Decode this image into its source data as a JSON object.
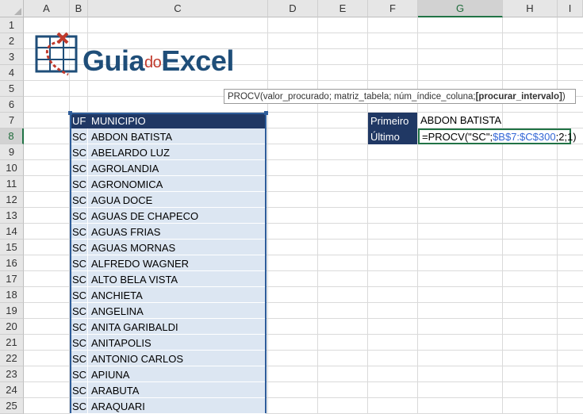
{
  "columns": [
    "A",
    "B",
    "C",
    "D",
    "E",
    "F",
    "G",
    "H",
    "I"
  ],
  "selected_column": "G",
  "rows": [
    "1",
    "2",
    "3",
    "4",
    "5",
    "6",
    "7",
    "8",
    "9",
    "10",
    "11",
    "12",
    "13",
    "14",
    "15",
    "16",
    "17",
    "18",
    "19",
    "20",
    "21",
    "22",
    "23",
    "24",
    "25"
  ],
  "selected_row": "8",
  "logo": {
    "part1": "Guia",
    "part2": "do",
    "part3": "Excel"
  },
  "tooltip": {
    "text": "PROCV(valor_procurado; matriz_tabela; núm_índice_coluna; ",
    "bold": "[procurar_intervalo]",
    "close": ")"
  },
  "table": {
    "header_uf": "UF",
    "header_municipio": "MUNICIPIO",
    "rows": [
      {
        "uf": "SC",
        "municipio": "ABDON BATISTA"
      },
      {
        "uf": "SC",
        "municipio": "ABELARDO LUZ"
      },
      {
        "uf": "SC",
        "municipio": "AGROLANDIA"
      },
      {
        "uf": "SC",
        "municipio": "AGRONOMICA"
      },
      {
        "uf": "SC",
        "municipio": "AGUA DOCE"
      },
      {
        "uf": "SC",
        "municipio": "AGUAS DE CHAPECO"
      },
      {
        "uf": "SC",
        "municipio": "AGUAS FRIAS"
      },
      {
        "uf": "SC",
        "municipio": "AGUAS MORNAS"
      },
      {
        "uf": "SC",
        "municipio": "ALFREDO WAGNER"
      },
      {
        "uf": "SC",
        "municipio": "ALTO BELA VISTA"
      },
      {
        "uf": "SC",
        "municipio": "ANCHIETA"
      },
      {
        "uf": "SC",
        "municipio": "ANGELINA"
      },
      {
        "uf": "SC",
        "municipio": "ANITA GARIBALDI"
      },
      {
        "uf": "SC",
        "municipio": "ANITAPOLIS"
      },
      {
        "uf": "SC",
        "municipio": "ANTONIO CARLOS"
      },
      {
        "uf": "SC",
        "municipio": "APIUNA"
      },
      {
        "uf": "SC",
        "municipio": "ARABUTA"
      },
      {
        "uf": "SC",
        "municipio": "ARAQUARI"
      }
    ]
  },
  "lookup": {
    "first_label": "Primeiro",
    "first_value": "ABDON BATISTA",
    "last_label": "Último",
    "formula_start": "=PROCV(\"SC\";",
    "formula_ref": "$B$7:$C$300",
    "formula_end": ";2;1)"
  },
  "colors": {
    "header_fill": "#203864",
    "row_fill": "#dce6f2",
    "selection": "#217346",
    "reference": "#3367d6"
  }
}
